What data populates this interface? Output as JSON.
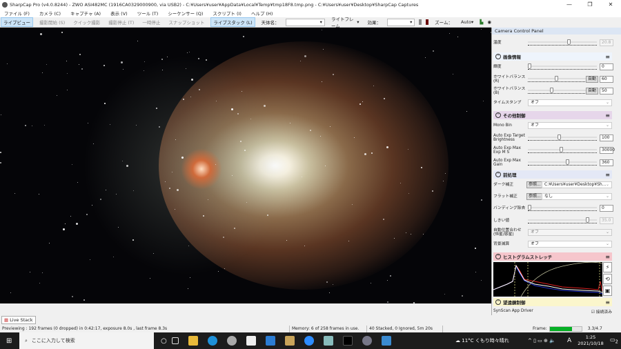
{
  "window": {
    "title": "SharpCap Pro (v4.0.8244) - ZWO ASI482MC (1916CA0329000900, via USB2) - C:¥Users¥user¥AppData¥Local¥Temp¥tmp18F8.tmp.png - C:¥Users¥user¥Desktop¥SharpCap Captures"
  },
  "menu": [
    "ファイル (F)",
    "カメラ (C)",
    "キャプチャ (A)",
    "表示 (V)",
    "ツール (T)",
    "シーケンサー (Q)",
    "スクリプト (I)",
    "ヘルプ (H)"
  ],
  "toolbar": {
    "live_view": "ライブビュー",
    "start_capture": "撮影開始 (S)",
    "quick_capture": "クイック撮影",
    "stop_capture": "撮影停止 (T)",
    "pause": "一時停止",
    "snapshot": "スナップショット",
    "live_stack": "ライブスタック (L)",
    "target_label": "天体名：",
    "target_value": "",
    "frame_type": "ライトフレーム",
    "effect_label": "効果：",
    "effect_value": "",
    "zoom_label": "ズーム：",
    "zoom_value": "Auto"
  },
  "panel": {
    "title": "Camera Control Panel",
    "temperature": {
      "label": "温度",
      "value": "20.8",
      "pos": 0.6
    },
    "image_info": {
      "title": "画像情報",
      "brightness": {
        "label": "輝度",
        "value": "0",
        "pos": 0
      },
      "wb_r": {
        "label": "ホワイトバランス(R)",
        "auto": "自動",
        "value": "60",
        "pos": 0.48
      },
      "wb_b": {
        "label": "ホワイトバランス(B)",
        "auto": "自動",
        "value": "50",
        "pos": 0.4
      },
      "timestamp": {
        "label": "タイムスタンプ",
        "value": "オフ"
      }
    },
    "misc": {
      "title": "その他制御",
      "mono_bin": {
        "label": "Mono Bin",
        "value": "オフ"
      },
      "ae_target": {
        "label": "Auto Exp Target Brightness",
        "value": "100",
        "pos": 0.45
      },
      "ae_max_exp": {
        "label": "Auto Exp Max Exp M S",
        "value": "30000",
        "pos": 0.48
      },
      "ae_max_gain": {
        "label": "Auto Exp Max Gain",
        "value": "360",
        "pos": 0.58
      }
    },
    "preprocess": {
      "title": "前処理",
      "dark": {
        "label": "ダーク補正",
        "browse": "参照...",
        "value": "C:¥Users¥user¥Desktop¥Sh..."
      },
      "flat": {
        "label": "フラット補正",
        "browse": "参照...",
        "value": "なし"
      },
      "banding": {
        "label": "バンディング除去",
        "value": "0",
        "pos": 0
      },
      "threshold": {
        "label": "しきい値",
        "value": "35.0",
        "pos": 0.88
      },
      "align": {
        "label": "自動位置合わせ (恒星/惑星)",
        "value": "オフ"
      },
      "bg_sub": {
        "label": "背景減算",
        "value": "オフ"
      }
    },
    "histogram": {
      "title": "ヒストグラムストレッチ"
    },
    "telescope": {
      "title": "望遠鏡制御",
      "driver": "SynScan App Driver",
      "connected": "接続済み"
    }
  },
  "tabs": {
    "live_stack": "Live Stack"
  },
  "status": {
    "preview": "Previewing : 192 frames (0 dropped) in 0:42:17, exposure 8.0s , last frame 8.3s",
    "memory": "Memory: 6 of 258 frames in use.",
    "stacked": "40 Stacked, 0 Ignored, 5m 20s",
    "frame_label": "Frame:",
    "frame_value": "3.3/4.7",
    "frame_progress": 0.7
  },
  "taskbar": {
    "search_placeholder": "ここに入力して検索",
    "weather": "11°C くもり時々晴れ",
    "ime": "A",
    "time": "1:25",
    "date": "2021/10/18",
    "notif_count": "2"
  }
}
